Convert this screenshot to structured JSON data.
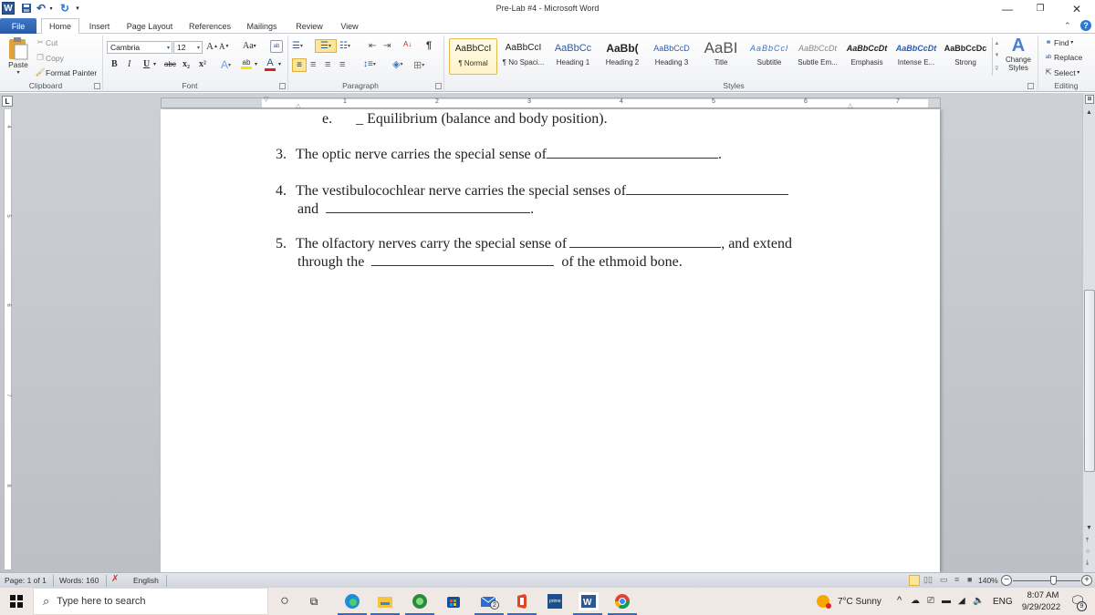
{
  "window": {
    "title": "Pre-Lab #4  -  Microsoft Word",
    "controls": {
      "minimize": "—",
      "restore": "❐",
      "close": "✕"
    }
  },
  "quick_access": {
    "icons": [
      "word-logo",
      "save",
      "undo",
      "redo",
      "customize"
    ]
  },
  "tabs": [
    {
      "label": "File"
    },
    {
      "label": "Home"
    },
    {
      "label": "Insert"
    },
    {
      "label": "Page Layout"
    },
    {
      "label": "References"
    },
    {
      "label": "Mailings"
    },
    {
      "label": "Review"
    },
    {
      "label": "View"
    }
  ],
  "ribbon": {
    "clipboard": {
      "label": "Clipboard",
      "paste": "Paste",
      "cut": "Cut",
      "copy": "Copy",
      "format_painter": "Format Painter"
    },
    "font": {
      "label": "Font",
      "font_name": "Cambria",
      "font_size": "12",
      "grow": "A",
      "shrink": "A",
      "change_case": "Aa",
      "bold": "B",
      "italic": "I",
      "underline": "U",
      "strikethrough": "abc",
      "subscript": "x₂",
      "superscript": "x²",
      "text_effects": "A",
      "highlight": "ab",
      "font_color": "A"
    },
    "paragraph": {
      "label": "Paragraph",
      "pilcrow": "¶",
      "sort": "A↓"
    },
    "styles": {
      "label": "Styles",
      "items": [
        {
          "sample": "AaBbCcI",
          "label": "¶ Normal",
          "selected": true
        },
        {
          "sample": "AaBbCcI",
          "label": "¶ No Spaci..."
        },
        {
          "sample": "AaBbCc",
          "label": "Heading 1"
        },
        {
          "sample": "AaBb(",
          "label": "Heading 2"
        },
        {
          "sample": "AaBbCcD",
          "label": "Heading 3"
        },
        {
          "sample": "AaBI",
          "label": "Title"
        },
        {
          "sample": "AaBbCcl",
          "label": "Subtitle"
        },
        {
          "sample": "AaBbCcDt",
          "label": "Subtle Em..."
        },
        {
          "sample": "AaBbCcDt",
          "label": "Emphasis"
        },
        {
          "sample": "AaBbCcDt",
          "label": "Intense E..."
        },
        {
          "sample": "AaBbCcDc",
          "label": "Strong"
        }
      ],
      "change_styles": "Change Styles"
    },
    "editing": {
      "label": "Editing",
      "find": "Find",
      "replace": "Replace",
      "select": "Select"
    }
  },
  "ruler": {
    "numbers": [
      "1",
      "2",
      "3",
      "4",
      "5",
      "6",
      "7"
    ],
    "vertical_numbers": [
      "4",
      "5",
      "6",
      "7",
      "8"
    ]
  },
  "document": {
    "line_e": {
      "marker": "e.",
      "text": "_ Equilibrium (balance and body position)."
    },
    "q3": {
      "num": "3.",
      "text": "The optic nerve carries the special sense of",
      "end": "."
    },
    "q4": {
      "num": "4.",
      "text": "The vestibulocochlear nerve carries the special senses of",
      "line2_start": "and",
      "end": "."
    },
    "q5": {
      "num": "5.",
      "text": "The olfactory nerves carry the special sense of",
      "mid": ", and extend",
      "line2_start": "through the",
      "line2_end": "of the ethmoid bone."
    }
  },
  "status_bar": {
    "page": "Page: 1 of 1",
    "words": "Words: 160",
    "language": "English",
    "zoom": "140%",
    "zoom_fraction": 0.6
  },
  "taskbar": {
    "search_placeholder": "Type here to search",
    "mail_badge": "2",
    "weather": "7°C  Sunny",
    "language": "ENG",
    "time": "8:07 AM",
    "date": "9/29/2022",
    "notification_count": "9"
  }
}
